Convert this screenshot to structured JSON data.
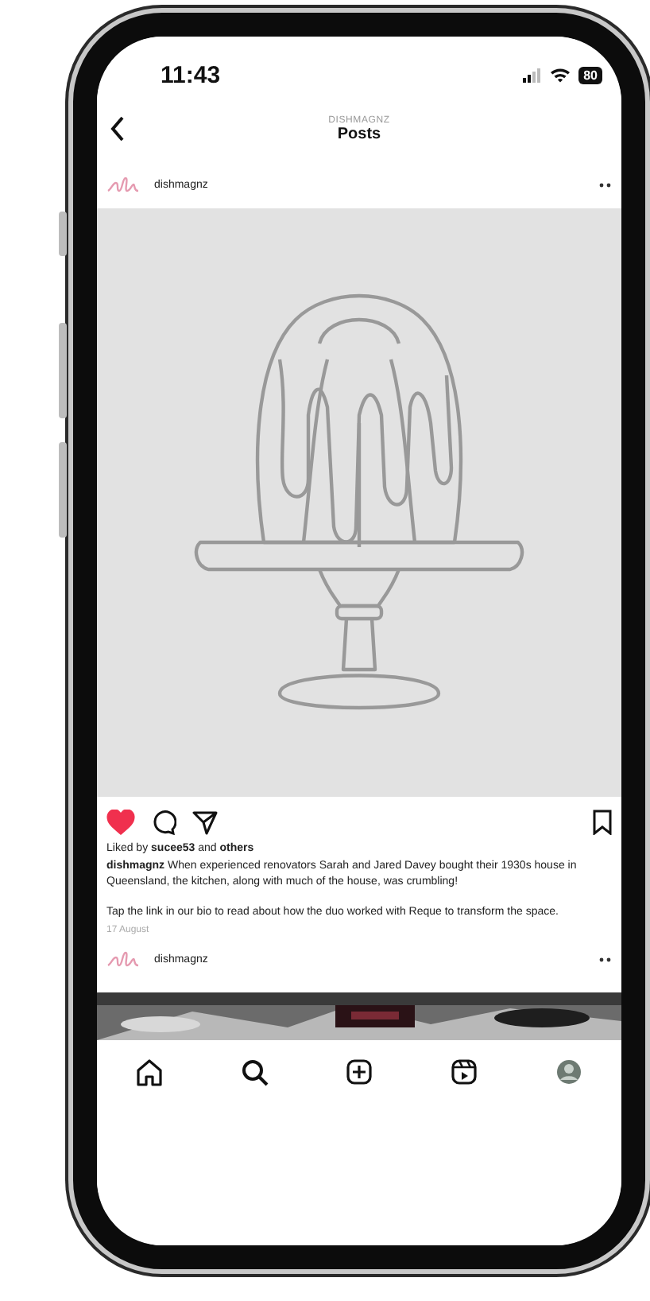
{
  "status_bar": {
    "time": "11:43",
    "battery": "80"
  },
  "header": {
    "subtitle": "DISHMAGNZ",
    "title": "Posts"
  },
  "posts": [
    {
      "username": "dishmagnz",
      "image": {
        "kind": "cake-drawing"
      },
      "liked": true,
      "liked_by": "Liked by **sucee53** and **others**",
      "caption": "**dishmagnz** When experienced renovators Sarah and Jared Davey bought their 1930s house in Queensland, the kitchen, along with much of the house, was crumbling!",
      "caption_2": "Tap the link in our bio to read about how the duo worked with Reque to transform the space.",
      "date": "17 August"
    },
    {
      "username": "dishmagnz"
    }
  ],
  "tab_bar": [
    {
      "kind": "home"
    },
    {
      "kind": "search"
    },
    {
      "kind": "create"
    },
    {
      "kind": "reels"
    },
    {
      "kind": "profile"
    }
  ]
}
